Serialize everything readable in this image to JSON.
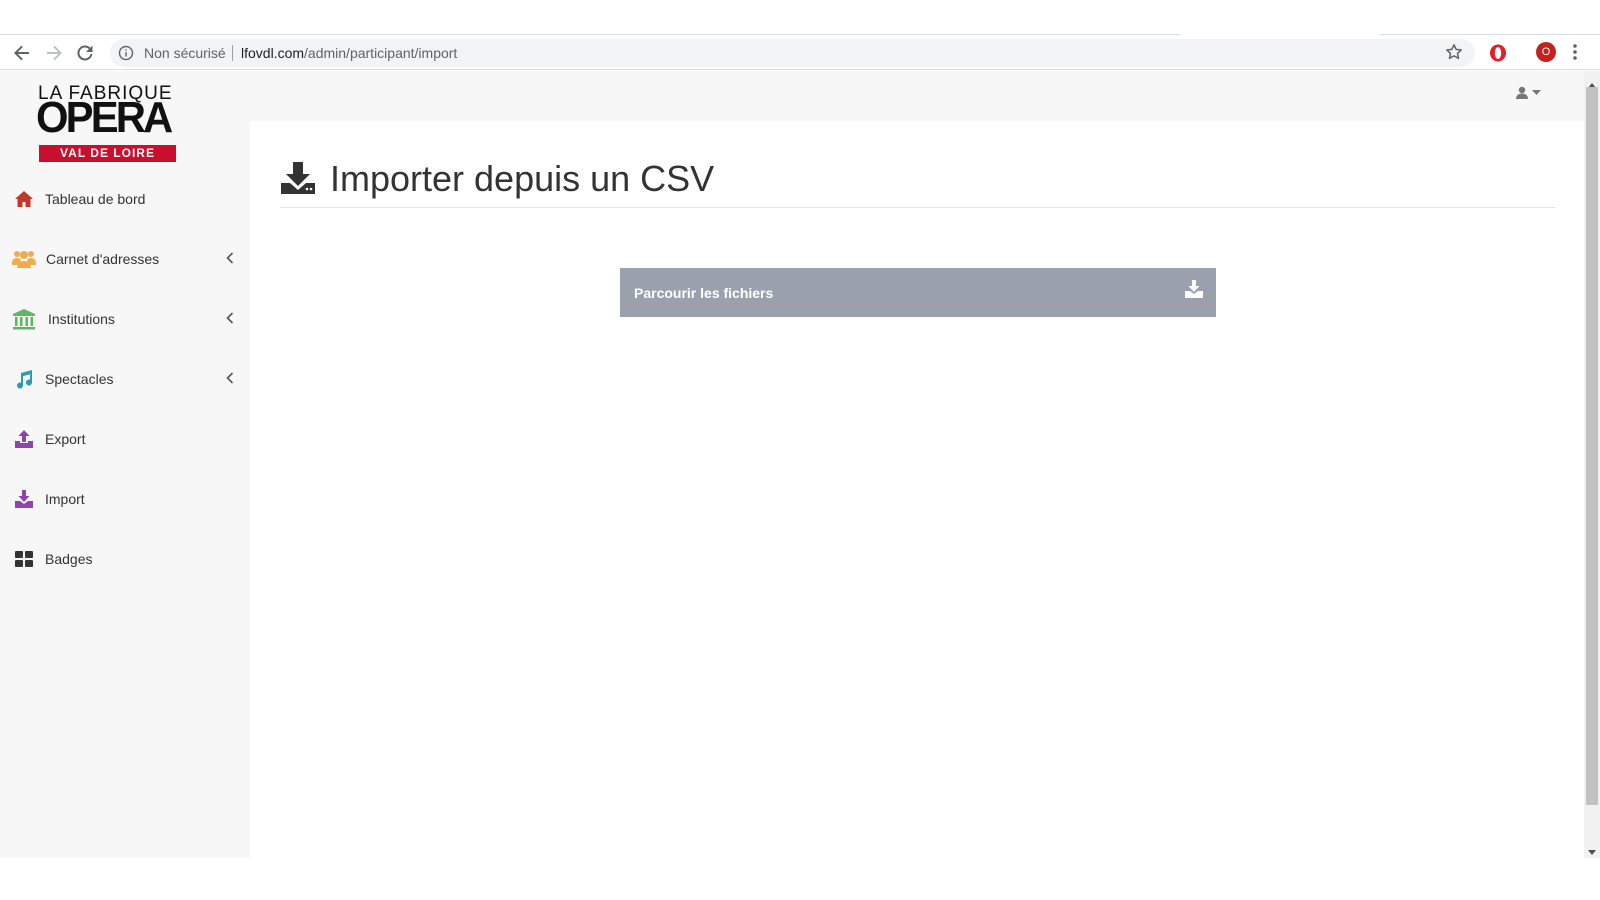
{
  "browser": {
    "security_label": "Non sécurisé",
    "url_host": "lfovdl.com",
    "url_path": "/admin/participant/import",
    "profile_badge": "O"
  },
  "logo": {
    "line1": "LA FABRIQUE",
    "line2": "OPERA",
    "line3": "VAL DE LOIRE"
  },
  "sidebar": {
    "items": [
      {
        "label": "Tableau de bord",
        "icon": "home-icon",
        "color": "#c0392b"
      },
      {
        "label": "Carnet d'adresses",
        "icon": "users-icon",
        "color": "#f0ad4e"
      },
      {
        "label": "Institutions",
        "icon": "institution-icon",
        "color": "#5cb85c"
      },
      {
        "label": "Spectacles",
        "icon": "music-icon",
        "color": "#2a9bb5"
      },
      {
        "label": "Export",
        "icon": "upload-icon",
        "color": "#8e44ad"
      },
      {
        "label": "Import",
        "icon": "download-icon",
        "color": "#8e44ad"
      },
      {
        "label": "Badges",
        "icon": "dashboard-icon",
        "color": "#333333"
      }
    ]
  },
  "page": {
    "title": "Importer depuis un CSV"
  },
  "upload": {
    "label": "Parcourir les fichiers"
  }
}
